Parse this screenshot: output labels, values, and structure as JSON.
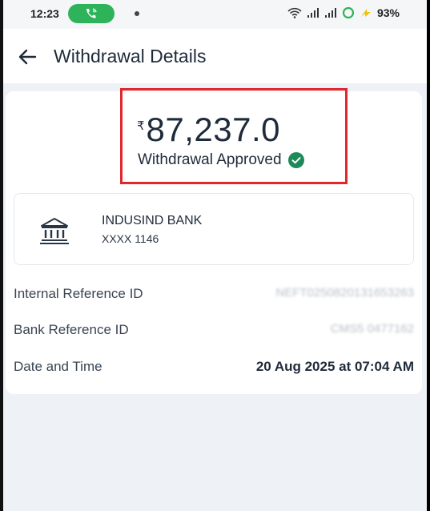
{
  "status_bar": {
    "time": "12:23",
    "battery_percent": "93%",
    "icons": [
      "wifi-icon",
      "signal-icon",
      "signal-icon",
      "ring-icon",
      "charging-icon"
    ]
  },
  "header": {
    "title": "Withdrawal Details"
  },
  "summary": {
    "currency_symbol": "₹",
    "amount": "87,237.0",
    "status": "Withdrawal Approved",
    "status_color": "#1e8a5a",
    "highlight_color": "#e1262c"
  },
  "bank": {
    "name": "INDUSIND BANK",
    "account": "XXXX 1146"
  },
  "details": [
    {
      "label": "Internal Reference ID",
      "value": "NEFT0250820131653263"
    },
    {
      "label": "Bank Reference ID",
      "value": "CMS5 0477162"
    },
    {
      "label": "Date and Time",
      "value": "20 Aug 2025 at 07:04 AM"
    }
  ]
}
